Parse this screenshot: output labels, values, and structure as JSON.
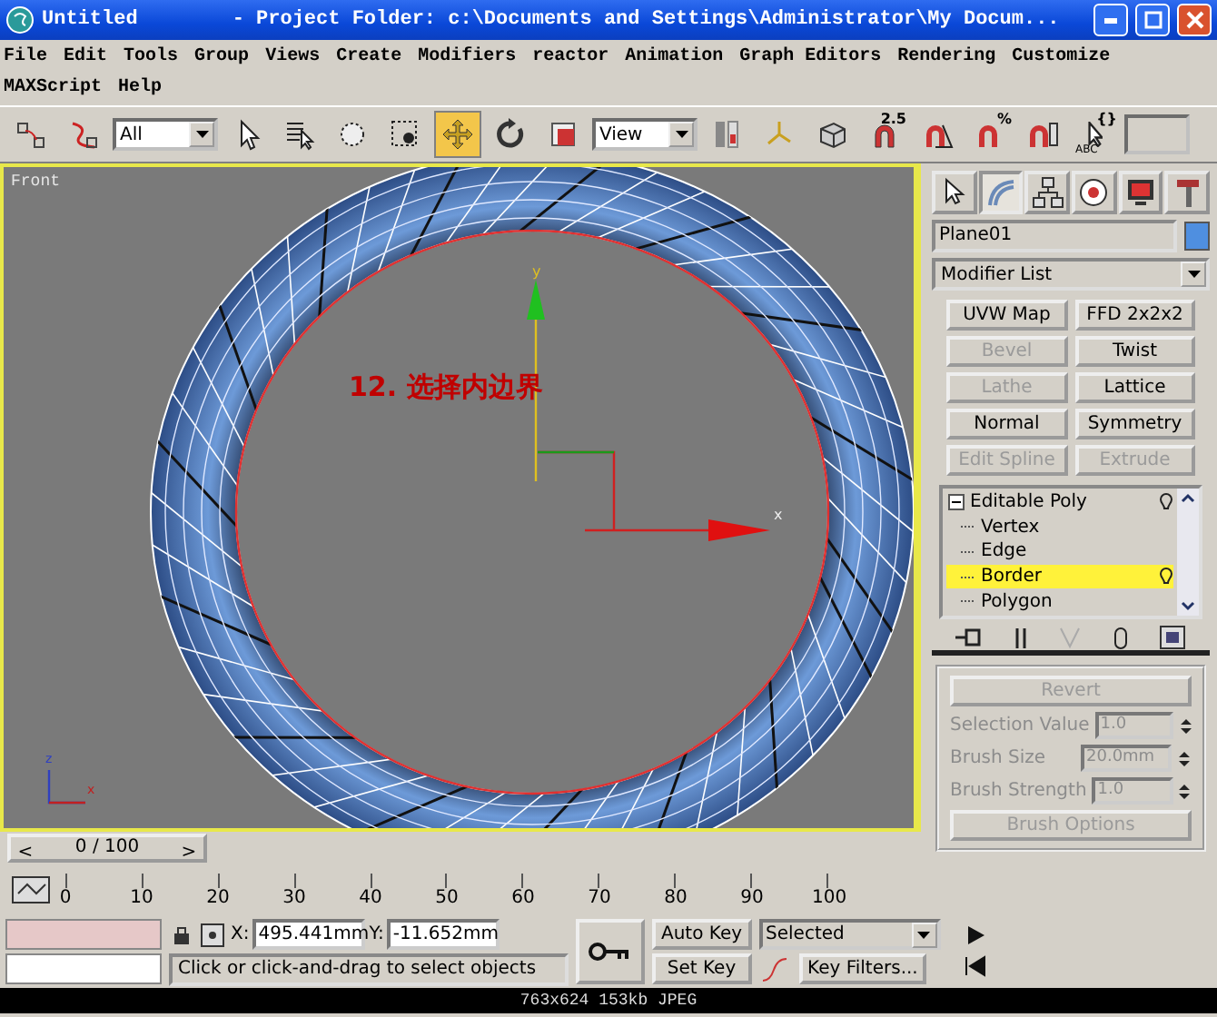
{
  "window": {
    "title": "Untitled",
    "project": "- Project Folder: c:\\Documents and Settings\\Administrator\\My Docum..."
  },
  "menu": [
    "File",
    "Edit",
    "Tools",
    "Group",
    "Views",
    "Create",
    "Modifiers",
    "reactor",
    "Animation",
    "Graph Editors",
    "Rendering",
    "Customize",
    "MAXScript",
    "Help"
  ],
  "toolbar": [
    {
      "kind": "tool",
      "selected": false
    },
    {
      "kind": "tool",
      "selected": false
    },
    {
      "kind": "dropdown",
      "value": "All"
    },
    {
      "kind": "tool",
      "selected": false
    },
    {
      "kind": "tool",
      "selected": false
    },
    {
      "kind": "tool",
      "selected": false
    },
    {
      "kind": "tool",
      "selected": false
    },
    {
      "kind": "tool",
      "selected": true
    },
    {
      "kind": "tool",
      "selected": false
    },
    {
      "kind": "tool",
      "selected": false
    },
    {
      "kind": "dropdown",
      "value": "View"
    },
    {
      "kind": "tool",
      "selected": false
    },
    {
      "kind": "tool",
      "selected": false
    },
    {
      "kind": "tool",
      "selected": false
    },
    {
      "kind": "tool",
      "selected": false,
      "badge": "2.5"
    },
    {
      "kind": "tool",
      "selected": false
    },
    {
      "kind": "tool",
      "selected": false,
      "badge": "%"
    },
    {
      "kind": "tool",
      "selected": false
    },
    {
      "kind": "tool",
      "selected": false,
      "badge": "{}",
      "sub_badge": "ABC"
    },
    {
      "kind": "field"
    }
  ],
  "viewport": {
    "label": "Front",
    "annotation": "12. 选择内边界",
    "gizmo_labels": [
      "y",
      "x"
    ],
    "tripod_labels": [
      "z",
      "x"
    ]
  },
  "command_panel": {
    "tabs": [
      {
        "selected": false
      },
      {
        "selected": true
      },
      {
        "selected": false
      },
      {
        "selected": false
      },
      {
        "selected": false
      },
      {
        "selected": false
      }
    ],
    "object_name": "Plane01",
    "modifier_list": "Modifier List",
    "modifier_buttons": [
      {
        "label": "UVW Map",
        "disabled": false
      },
      {
        "label": "FFD 2x2x2",
        "disabled": false
      },
      {
        "label": "Bevel",
        "disabled": true
      },
      {
        "label": "Twist",
        "disabled": false
      },
      {
        "label": "Lathe",
        "disabled": true
      },
      {
        "label": "Lattice",
        "disabled": false
      },
      {
        "label": "Normal",
        "disabled": false
      },
      {
        "label": "Symmetry",
        "disabled": false
      },
      {
        "label": "Edit Spline",
        "disabled": true
      },
      {
        "label": "Extrude",
        "disabled": true
      }
    ],
    "stack": [
      {
        "label": "Editable Poly",
        "expanded": true,
        "selected": false,
        "children": [
          {
            "label": "Vertex",
            "selected": false
          },
          {
            "label": "Edge",
            "selected": false
          },
          {
            "label": "Border",
            "selected": true
          },
          {
            "label": "Polygon",
            "selected": false
          }
        ]
      }
    ],
    "rollout": {
      "revert": {
        "label": "Revert",
        "disabled": true
      },
      "fields": [
        {
          "label": "Selection Value",
          "value": "1.0",
          "disabled": true
        },
        {
          "label": "Brush Size",
          "value": "20.0mm",
          "disabled": true
        },
        {
          "label": "Brush Strength",
          "value": "1.0",
          "disabled": true
        }
      ],
      "brush_options": {
        "label": "Brush Options",
        "disabled": true
      }
    }
  },
  "time_slider": {
    "prev": "<",
    "label": "0 / 100",
    "next": ">",
    "level": 0
  },
  "trackbar": {
    "ticks": [
      "0",
      "10",
      "20",
      "30",
      "40",
      "50",
      "60",
      "70",
      "80",
      "90",
      "100"
    ]
  },
  "status": {
    "x_label": "X:",
    "x": "495.441mm",
    "y_label": "Y:",
    "y": "-11.652mm",
    "auto_key": "Auto Key",
    "set_key": "Set Key",
    "key_mode": "Selected",
    "key_filters": "Key Filters...",
    "prompt": "Click or click-and-drag to select objects"
  },
  "caption": "763x624  153kb  JPEG"
}
